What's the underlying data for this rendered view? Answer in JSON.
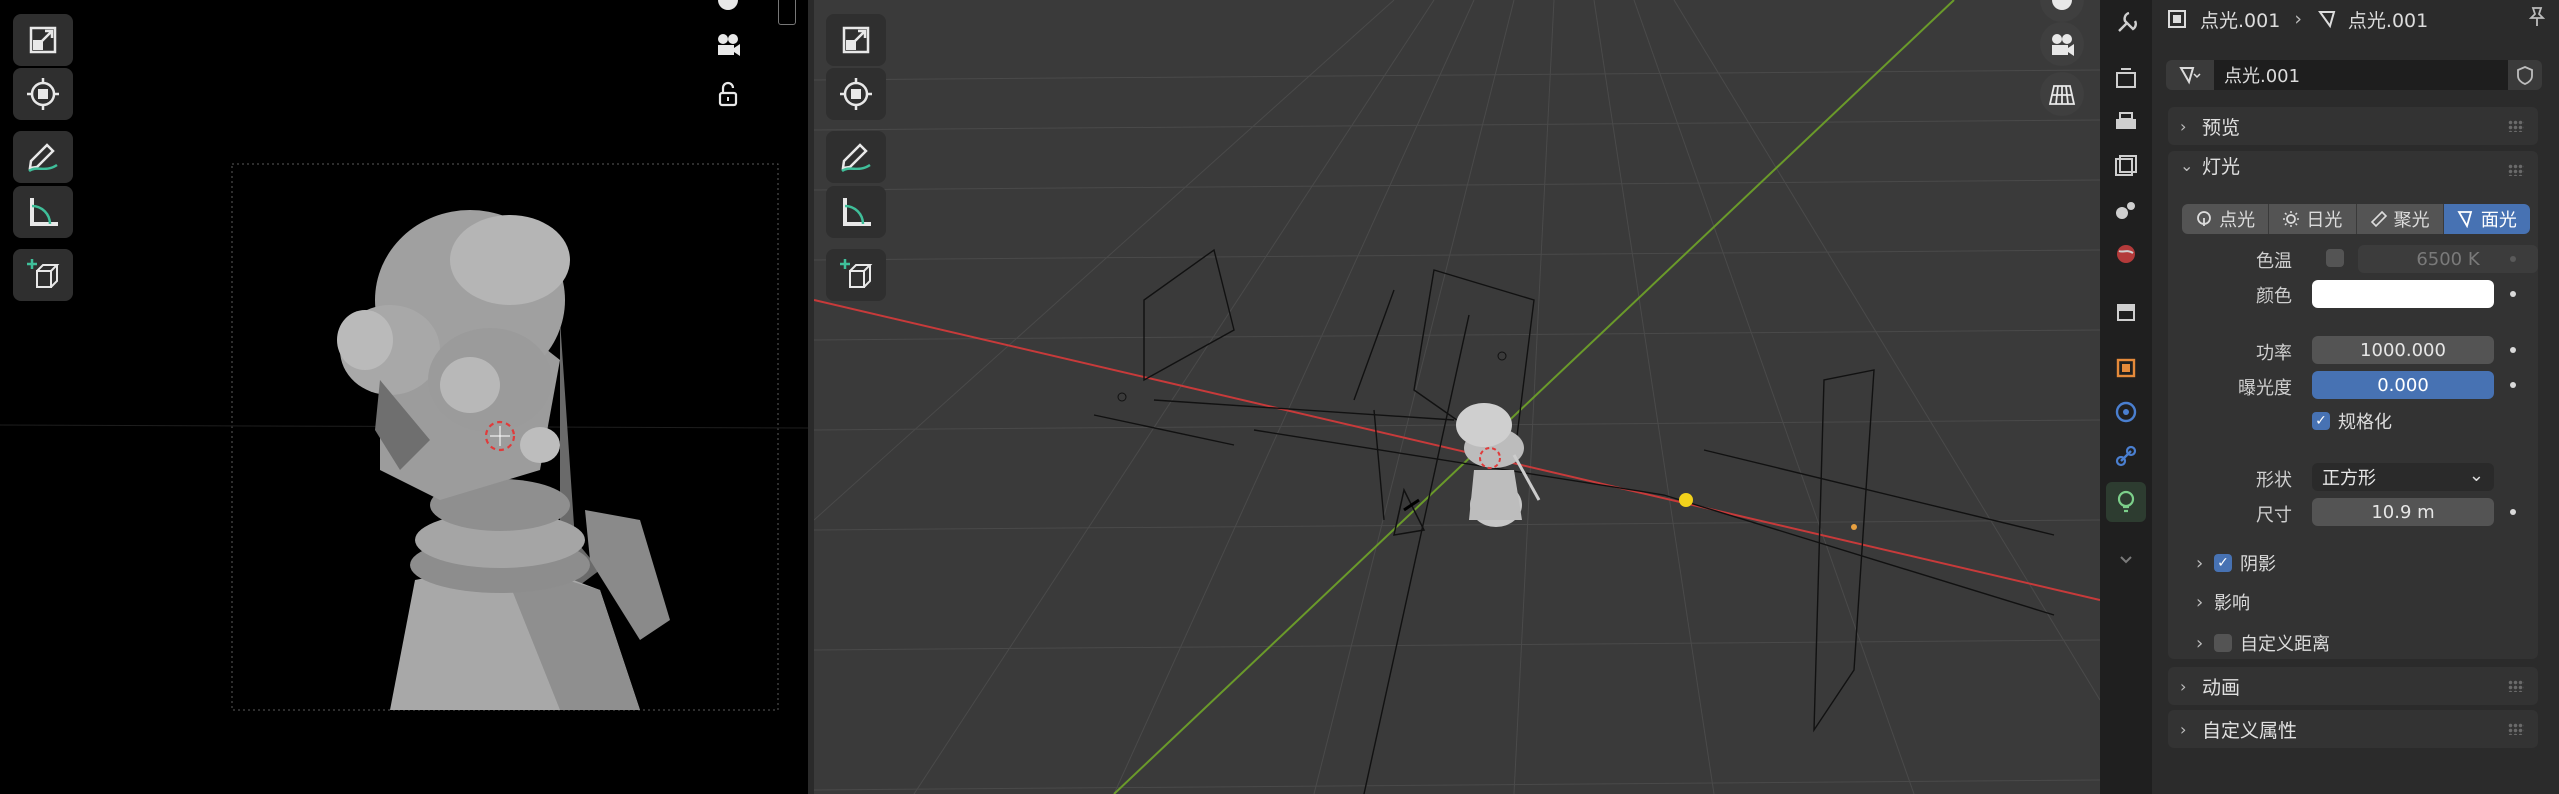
{
  "breadcrumb": {
    "object_name": "点光.001",
    "data_name": "点光.001"
  },
  "datablock": {
    "name": "点光.001"
  },
  "sections": {
    "preview": "预览",
    "light": "灯光",
    "animation": "动画",
    "custom_props": "自定义属性"
  },
  "light_types": [
    {
      "label": "点光",
      "active": false
    },
    {
      "label": "日光",
      "active": false
    },
    {
      "label": "聚光",
      "active": false
    },
    {
      "label": "面光",
      "active": true
    }
  ],
  "properties": {
    "color_temp_label": "色温",
    "color_temp_value": "6500 K",
    "color_label": "颜色",
    "color_value": "#ffffff",
    "power_label": "功率",
    "power_value": "1000.000",
    "exposure_label": "曝光度",
    "exposure_value": "0.000",
    "normalize_label": "规格化",
    "shape_label": "形状",
    "shape_value": "正方形",
    "size_label": "尺寸",
    "size_value": "10.9 m"
  },
  "subsections": {
    "shadow": "阴影",
    "influence": "影响",
    "custom_distance": "自定义距离"
  },
  "colors": {
    "accent": "#4772b3",
    "active_tab": "#7ccf8a",
    "x_axis": "#c83a3a",
    "y_axis": "#6a9a2a",
    "light_gizmo": "#f2d21b"
  },
  "icons": {
    "tabs": [
      "wrench-icon",
      "render-icon",
      "output-icon",
      "view-layer-icon",
      "scene-icon",
      "world-icon",
      "collection-icon",
      "object-icon",
      "physics-icon",
      "constraints-icon",
      "light-data-icon"
    ]
  }
}
